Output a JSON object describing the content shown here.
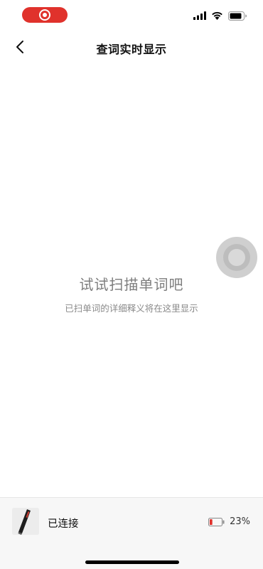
{
  "status_bar": {
    "recording_color": "#e0322c",
    "icons": [
      "signal-icon",
      "wifi-icon",
      "battery-icon"
    ]
  },
  "nav": {
    "back_icon": "chevron-left-icon",
    "title": "查词实时显示"
  },
  "empty_state": {
    "title": "试试扫描单词吧",
    "subtitle": "已扫单词的详细释义将在这里显示"
  },
  "float_button": {
    "icon": "assistive-touch-icon"
  },
  "device": {
    "status": "已连接",
    "battery_percent": "23%",
    "battery_level": 0.23,
    "battery_color": "#e0322c"
  }
}
